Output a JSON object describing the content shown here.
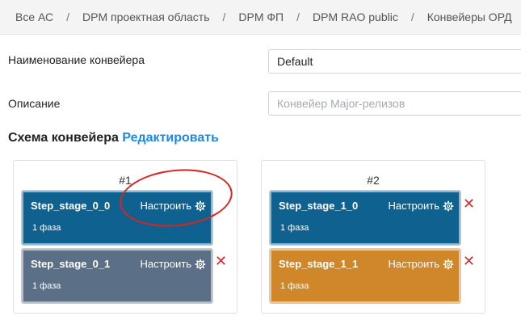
{
  "breadcrumb": [
    "Все АС",
    "DPM проектная область",
    "DPM ФП",
    "DPM RAO public",
    "Конвейеры ОРД"
  ],
  "form": {
    "name_label": "Наименование конвейера",
    "name_value": "Default",
    "desc_label": "Описание",
    "desc_placeholder": "Конвейер Major-релизов"
  },
  "schema": {
    "title": "Схема конвейера",
    "edit_link": "Редактировать"
  },
  "groups": [
    {
      "number": "#1",
      "stages": [
        {
          "name": "Step_stage_0_0",
          "config": "Настроить",
          "phase": "1 фаза",
          "color": "#0f6190"
        },
        {
          "name": "Step_stage_0_1",
          "config": "Настроить",
          "phase": "1 фаза",
          "color": "#5b6f87"
        }
      ]
    },
    {
      "number": "#2",
      "stages": [
        {
          "name": "Step_stage_1_0",
          "config": "Настроить",
          "phase": "1 фаза",
          "color": "#0f6190"
        },
        {
          "name": "Step_stage_1_1",
          "config": "Настроить",
          "phase": "1 фаза",
          "color": "#d08729"
        }
      ]
    }
  ],
  "icons": {
    "config": "gear-icon",
    "remove": "close-icon"
  },
  "colors": {
    "accent": "#1e88e5",
    "remove": "#d32f2f",
    "annotation": "#d9251c"
  }
}
